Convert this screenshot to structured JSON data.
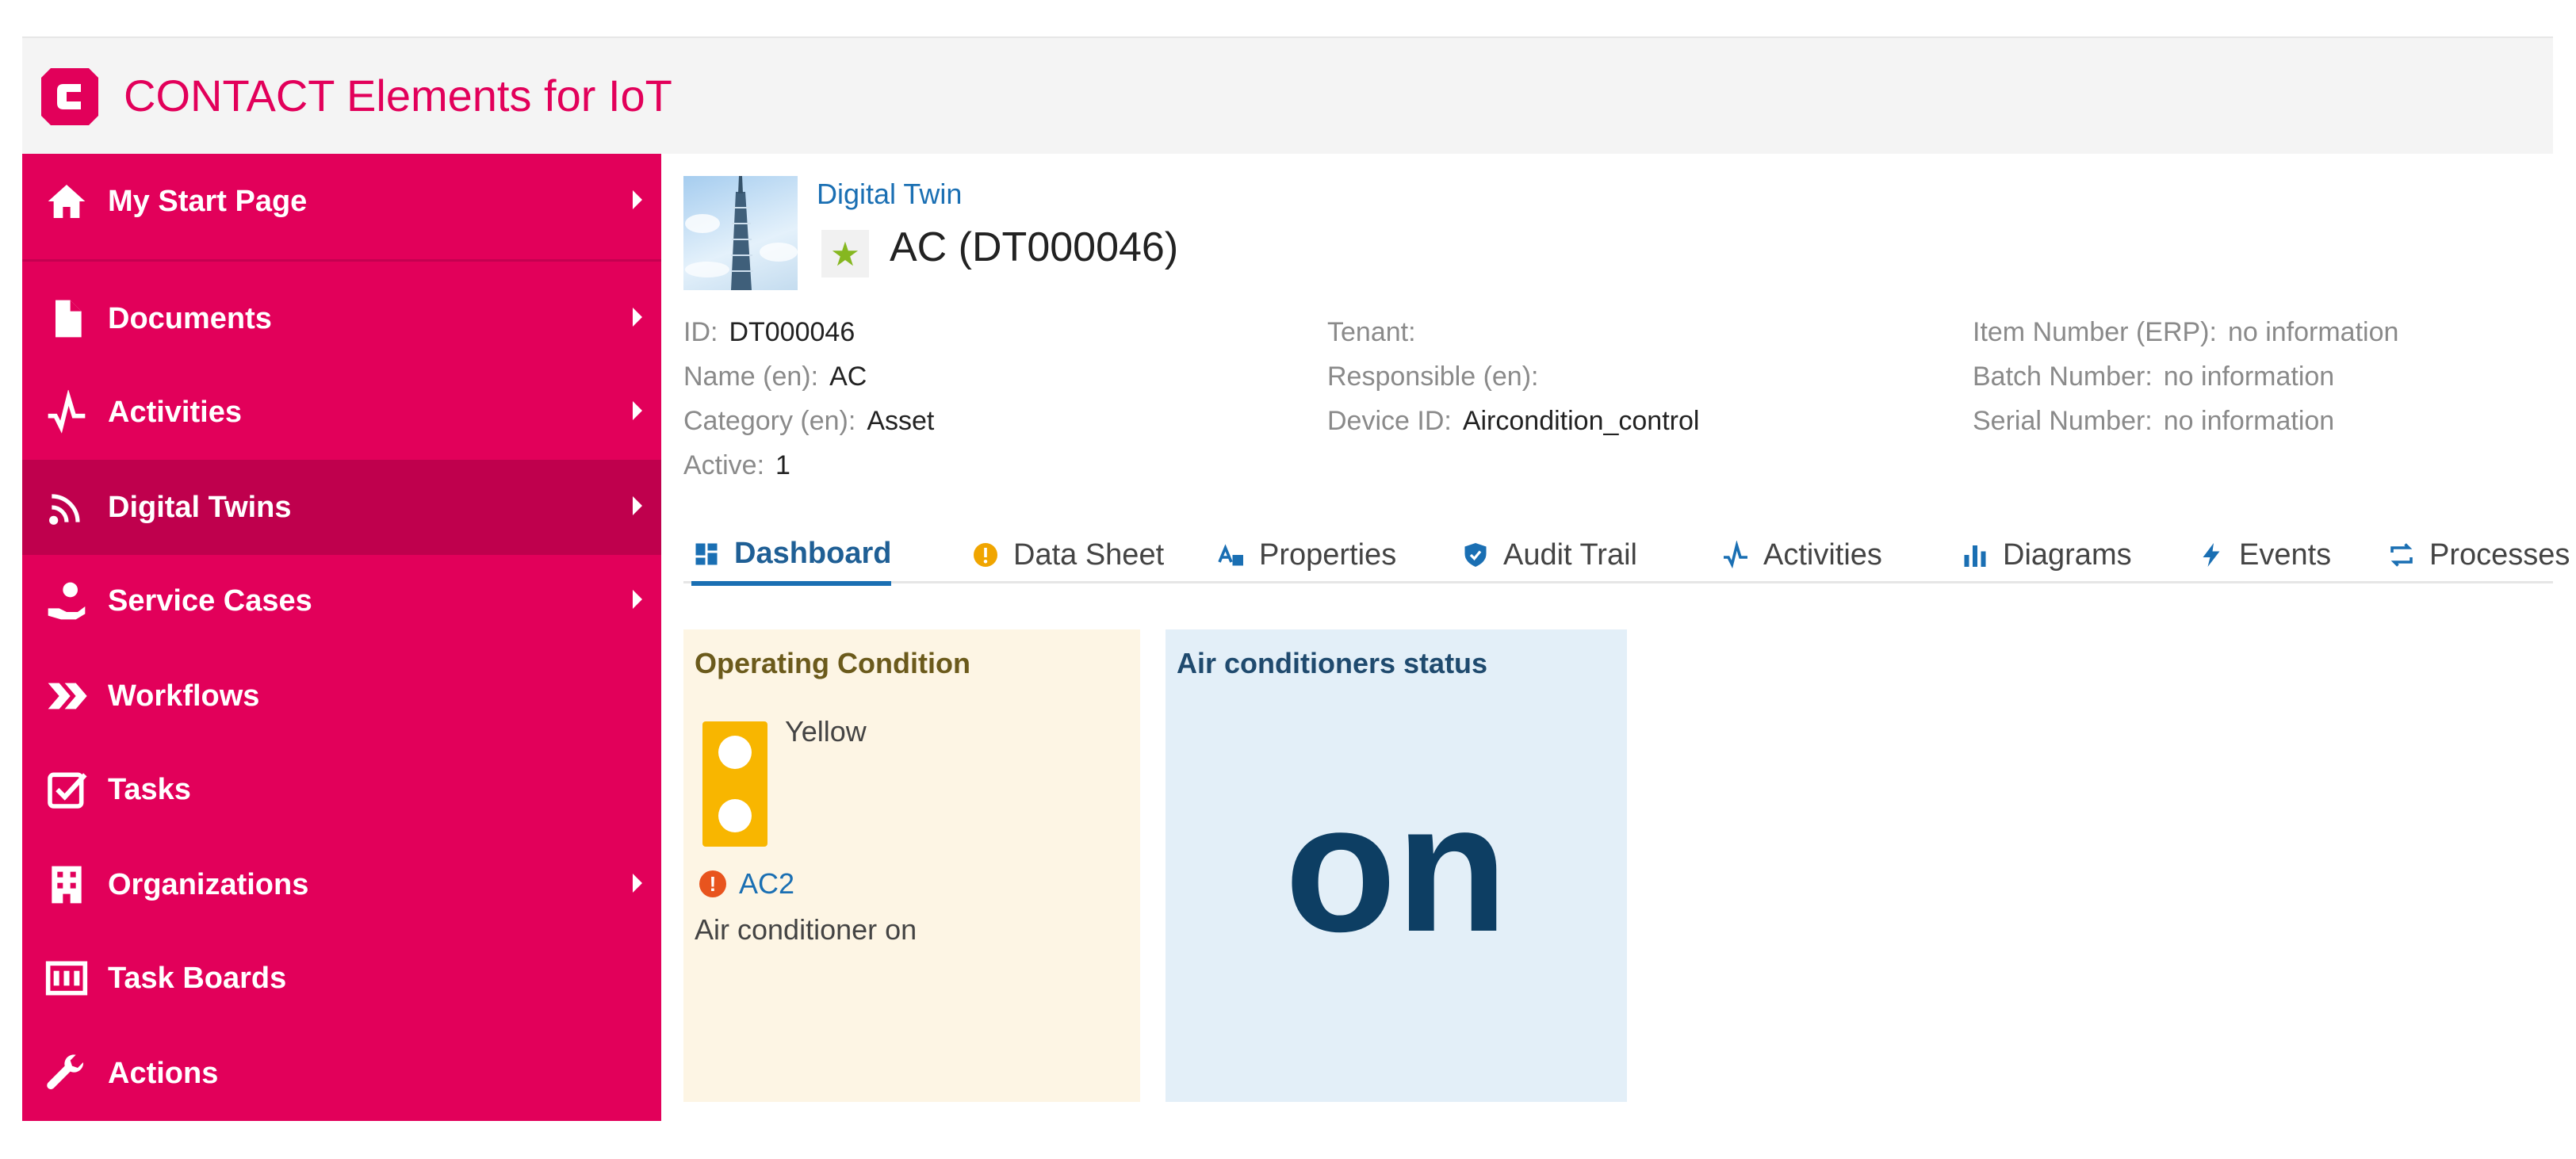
{
  "app": {
    "title": "CONTACT Elements for IoT",
    "logo_letter": "C",
    "brand_color": "#e2005a"
  },
  "sidebar": {
    "items": [
      {
        "label": "My Start Page",
        "icon": "home-icon",
        "has_submenu": true
      },
      {
        "label": "Documents",
        "icon": "document-icon",
        "has_submenu": true
      },
      {
        "label": "Activities",
        "icon": "activity-icon",
        "has_submenu": true
      },
      {
        "label": "Digital Twins",
        "icon": "signal-icon",
        "has_submenu": true,
        "selected": true
      },
      {
        "label": "Service Cases",
        "icon": "service-hand-icon",
        "has_submenu": true
      },
      {
        "label": "Workflows",
        "icon": "double-chevron-icon",
        "has_submenu": false
      },
      {
        "label": "Tasks",
        "icon": "checkbox-icon",
        "has_submenu": false
      },
      {
        "label": "Organizations",
        "icon": "building-icon",
        "has_submenu": true
      },
      {
        "label": "Task Boards",
        "icon": "board-icon",
        "has_submenu": false
      },
      {
        "label": "Actions",
        "icon": "wrench-icon",
        "has_submenu": false
      }
    ]
  },
  "object": {
    "breadcrumb": "Digital Twin",
    "title": "AC (DT000046)",
    "favorite_icon": "star-icon",
    "attributes": {
      "id": {
        "label": "ID:",
        "value": "DT000046"
      },
      "name": {
        "label": "Name (en):",
        "value": "AC"
      },
      "category": {
        "label": "Category (en):",
        "value": "Asset"
      },
      "active": {
        "label": "Active:",
        "value": "1"
      },
      "tenant": {
        "label": "Tenant:",
        "value": ""
      },
      "responsible": {
        "label": "Responsible (en):",
        "value": ""
      },
      "device_id": {
        "label": "Device ID:",
        "value": "Aircondition_control"
      },
      "item_number": {
        "label": "Item Number (ERP):",
        "value": "no information"
      },
      "batch_number": {
        "label": "Batch Number:",
        "value": "no information"
      },
      "serial_number": {
        "label": "Serial Number:",
        "value": "no information"
      }
    }
  },
  "tabs": [
    {
      "label": "Dashboard",
      "icon": "dashboard-icon",
      "active": true
    },
    {
      "label": "Data Sheet",
      "icon": "info-icon"
    },
    {
      "label": "Properties",
      "icon": "properties-icon"
    },
    {
      "label": "Audit Trail",
      "icon": "shield-icon"
    },
    {
      "label": "Activities",
      "icon": "activity-icon"
    },
    {
      "label": "Diagrams",
      "icon": "bar-chart-icon"
    },
    {
      "label": "Events",
      "icon": "lightning-icon"
    },
    {
      "label": "Processes",
      "icon": "cycle-icon"
    }
  ],
  "widgets": {
    "operating_condition": {
      "title": "Operating Condition",
      "state_label": "Yellow",
      "state_color": "#f8b600",
      "alert_icon": "exclamation-icon",
      "alert_link": "AC2",
      "alert_message": "Air conditioner on"
    },
    "ac_status": {
      "title": "Air conditioners status",
      "value": "on"
    }
  }
}
